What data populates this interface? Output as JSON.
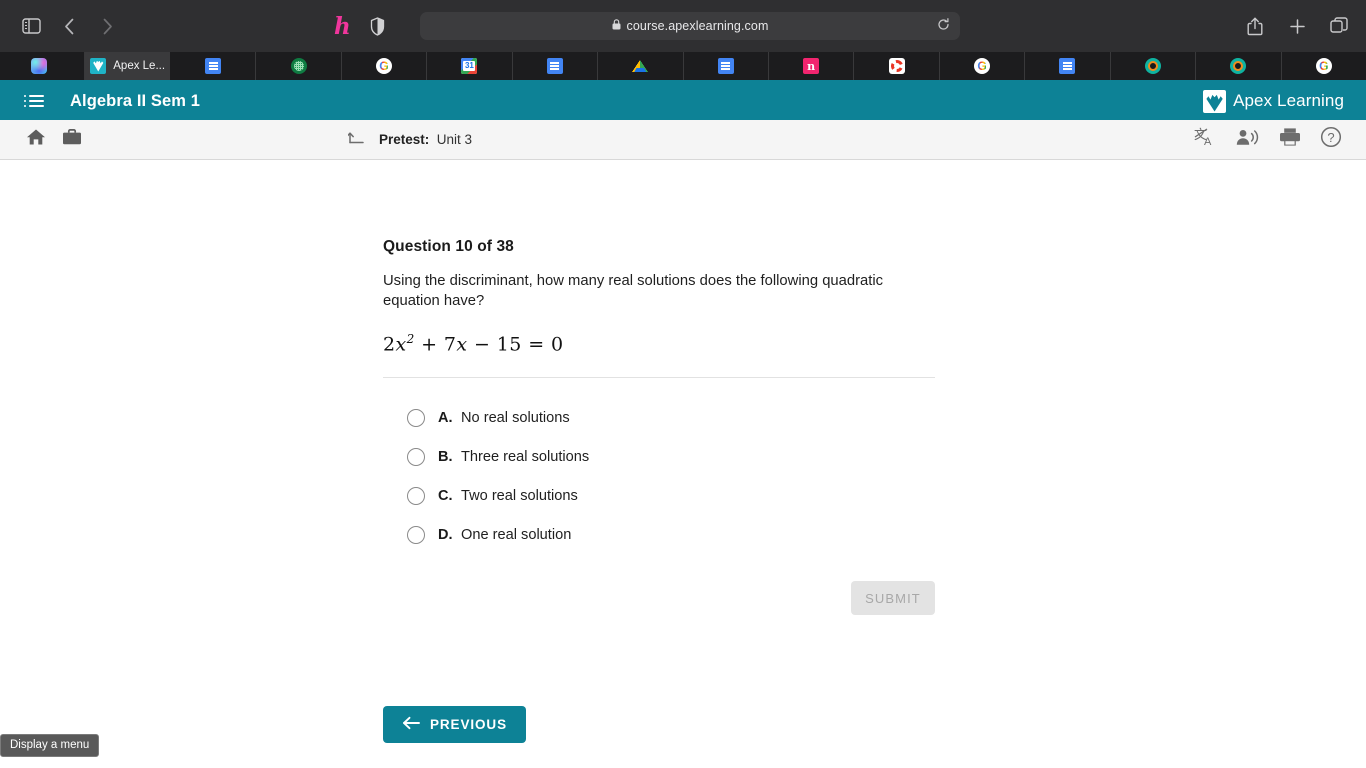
{
  "browser": {
    "sidebar_icon": "sidebar-toggle-icon",
    "back_label": "‹",
    "forward_label": "›",
    "extension_h_label": "h",
    "shield_icon": "shield-icon",
    "url": "course.apexlearning.com",
    "lock_icon": "lock-icon",
    "reload_icon": "reload-icon",
    "share_icon": "share-icon",
    "newtab_icon": "plus-icon",
    "tabs_overview_icon": "tab-overview-icon",
    "tabs": [
      {
        "label": "",
        "favicon": "copilot-icon",
        "active": false
      },
      {
        "label": "Apex Le...",
        "favicon": "apex-learning-icon",
        "active": true
      },
      {
        "label": "",
        "favicon": "google-docs-icon",
        "active": false
      },
      {
        "label": "",
        "favicon": "green-circle-icon",
        "active": false
      },
      {
        "label": "",
        "favicon": "google-icon",
        "active": false
      },
      {
        "label": "",
        "favicon": "google-calendar-icon",
        "active": false
      },
      {
        "label": "",
        "favicon": "google-docs-icon",
        "active": false
      },
      {
        "label": "",
        "favicon": "google-drive-icon",
        "active": false
      },
      {
        "label": "",
        "favicon": "google-docs-icon",
        "active": false
      },
      {
        "label": "",
        "favicon": "pink-n-icon",
        "active": false
      },
      {
        "label": "",
        "favicon": "red-ring-icon",
        "active": false
      },
      {
        "label": "",
        "favicon": "google-icon",
        "active": false
      },
      {
        "label": "",
        "favicon": "google-docs-icon",
        "active": false
      },
      {
        "label": "",
        "favicon": "teal-ring-icon",
        "active": false
      },
      {
        "label": "",
        "favicon": "teal-ring-icon",
        "active": false
      },
      {
        "label": "",
        "favicon": "google-icon",
        "active": false
      }
    ]
  },
  "app_header": {
    "menu_icon": "hamburger-menu-icon",
    "course_title": "Algebra II Sem 1",
    "brand_name": "Apex Learning",
    "brand_tm": "·",
    "brand_icon": "apex-shell-logo-icon",
    "accent_color": "#0d8296"
  },
  "subbar": {
    "home_icon": "home-icon",
    "briefcase_icon": "briefcase-icon",
    "return_icon": "return-arrow-icon",
    "activity_label": "Pretest:",
    "activity_value": "Unit 3",
    "translate_icon": "translate-icon",
    "read_aloud_icon": "read-aloud-icon",
    "print_icon": "print-icon",
    "help_icon": "help-icon"
  },
  "question": {
    "title": "Question 10 of 38",
    "prompt": "Using the discriminant, how many real solutions does the following quadratic equation have?",
    "equation": "2x² + 7x − 15 = 0",
    "equation_parts": {
      "coef1": "2",
      "var1": "x",
      "exp1": "2",
      "plus": "+",
      "coef2": "7",
      "var2": "x",
      "minus": "−",
      "const": "15",
      "equals": "=",
      "rhs": "0"
    },
    "options": [
      {
        "letter": "A.",
        "text": "No real solutions",
        "selected": false
      },
      {
        "letter": "B.",
        "text": "Three real solutions",
        "selected": false
      },
      {
        "letter": "C.",
        "text": "Two real solutions",
        "selected": false
      },
      {
        "letter": "D.",
        "text": "One real solution",
        "selected": false
      }
    ],
    "submit_label": "SUBMIT",
    "submit_disabled": true
  },
  "footer": {
    "previous_label": "PREVIOUS",
    "previous_arrow_icon": "arrow-left-icon"
  },
  "status": {
    "tooltip": "Display a menu"
  }
}
